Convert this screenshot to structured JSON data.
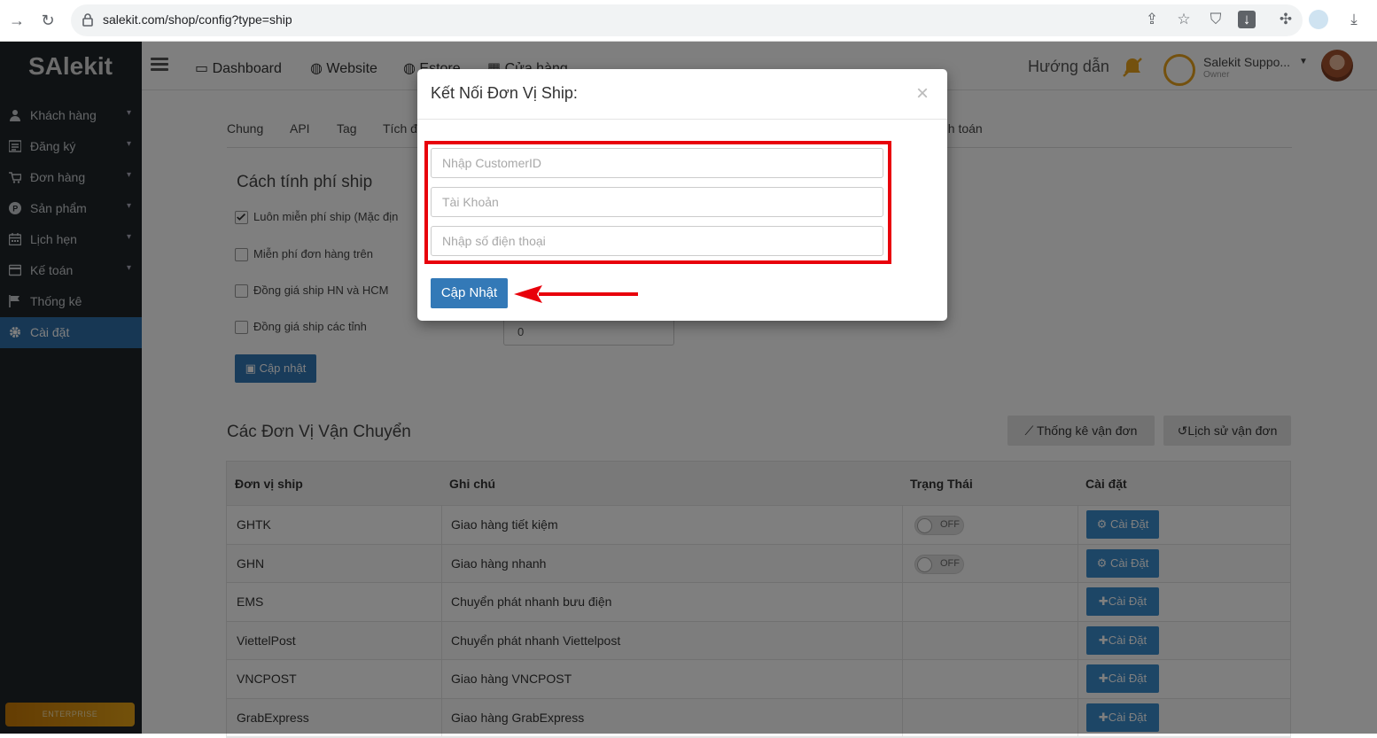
{
  "browser": {
    "url": "salekit.com/shop/config?type=ship"
  },
  "sidebar": {
    "logo": "SAlekit",
    "items": [
      {
        "label": "Khách hàng",
        "icon": "user-icon"
      },
      {
        "label": "Đăng ký",
        "icon": "register-icon"
      },
      {
        "label": "Đơn hàng",
        "icon": "cart-icon"
      },
      {
        "label": "Sản phẩm",
        "icon": "product-icon"
      },
      {
        "label": "Lịch hẹn",
        "icon": "calendar-icon"
      },
      {
        "label": "Kế toán",
        "icon": "accounting-icon"
      },
      {
        "label": "Thống kê",
        "icon": "flag-icon"
      },
      {
        "label": "Cài đặt",
        "icon": "gear-icon",
        "active": true
      }
    ],
    "plan": "ENTERPRISE"
  },
  "topnav": {
    "links": [
      "Dashboard",
      "Website",
      "Estore",
      "Cửa hàng"
    ],
    "guide": "Hướng dẫn",
    "shop_name": "Salekit Suppo...",
    "shop_role": "Owner"
  },
  "tabs": [
    "Chung",
    "API",
    "Tag",
    "Tích đ",
    "nh toán"
  ],
  "shipping_fee": {
    "title": "Cách tính phí ship",
    "options": [
      {
        "label": "Luôn miễn phí ship (Mặc địn",
        "checked": true
      },
      {
        "label": "Miễn phí đơn hàng trên",
        "checked": false
      },
      {
        "label": "Đồng giá ship HN và HCM",
        "checked": false
      },
      {
        "label": "Đồng giá ship các tỉnh",
        "checked": false
      }
    ],
    "province_value": "0",
    "update_label": "Cập nhật"
  },
  "carriers": {
    "title": "Các Đơn Vị Vận Chuyển",
    "stats_button": "Thống kê vận đơn",
    "history_button": "Lịch sử vận đơn",
    "columns": [
      "Đơn vị ship",
      "Ghi chú",
      "Trạng Thái",
      "Cài đặt"
    ],
    "rows": [
      {
        "name": "GHTK",
        "note": "Giao hàng tiết kiệm",
        "status": "OFF",
        "action": "Cài Đặt",
        "has_toggle": true
      },
      {
        "name": "GHN",
        "note": "Giao hàng nhanh",
        "status": "OFF",
        "action": "Cài Đặt",
        "has_toggle": true
      },
      {
        "name": "EMS",
        "note": "Chuyển phát nhanh bưu điện",
        "status": "",
        "action": "Cài Đặt",
        "has_toggle": false
      },
      {
        "name": "ViettelPost",
        "note": "Chuyển phát nhanh Viettelpost",
        "status": "",
        "action": "Cài Đặt",
        "has_toggle": false
      },
      {
        "name": "VNCPOST",
        "note": "Giao hàng VNCPOST",
        "status": "",
        "action": "Cài Đặt",
        "has_toggle": false
      },
      {
        "name": "GrabExpress",
        "note": "Giao hàng GrabExpress",
        "status": "",
        "action": "Cài Đặt",
        "has_toggle": false
      }
    ]
  },
  "modal": {
    "title": "Kết Nối Đơn Vị Ship:",
    "close": "×",
    "fields": [
      {
        "placeholder": "Nhập CustomerID",
        "value": ""
      },
      {
        "placeholder": "Tài Khoản",
        "value": ""
      },
      {
        "placeholder": "Nhập số điện thoại",
        "value": ""
      }
    ],
    "submit_label": "Cập Nhật",
    "highlight_color": "#e8000b"
  }
}
